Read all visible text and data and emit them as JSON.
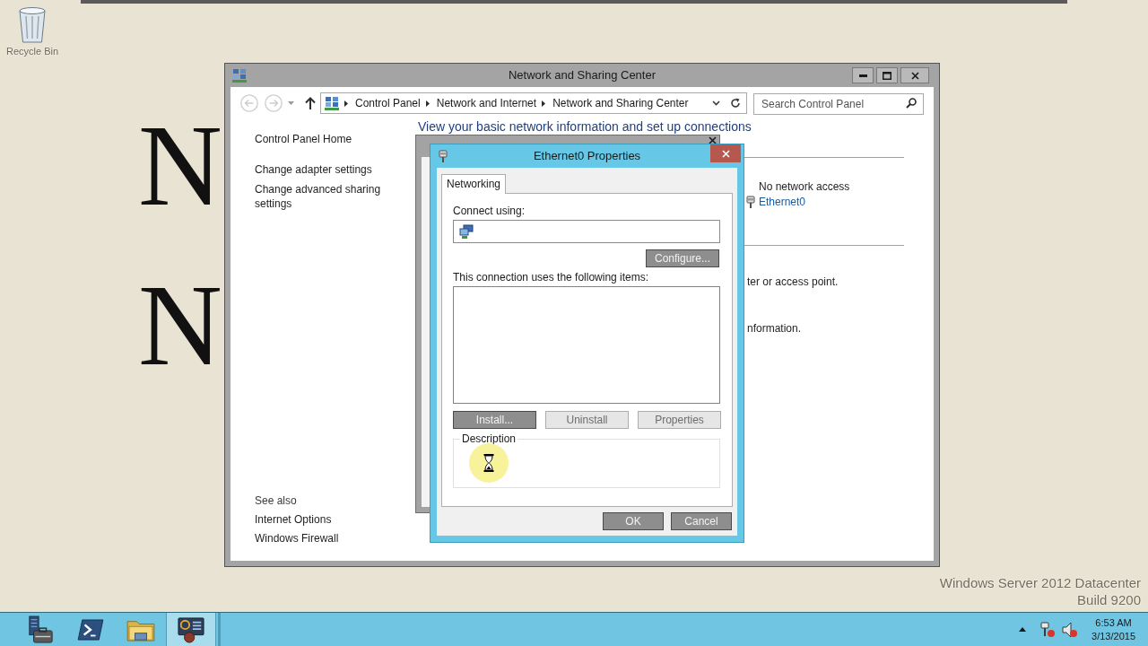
{
  "desktop": {
    "icons": [
      {
        "label": "Recycle Bin"
      }
    ],
    "background_letters": [
      "N",
      "N"
    ],
    "watermark": {
      "edition": "Windows Server 2012 Datacenter",
      "build": "Build 9200"
    }
  },
  "window": {
    "title": "Network and Sharing Center",
    "active": false,
    "nav": {
      "back": {
        "disabled": true
      },
      "forward": {
        "disabled": true
      },
      "up": {
        "disabled": false
      }
    },
    "address": {
      "breadcrumbs": [
        "Control Panel",
        "Network and Internet",
        "Network and Sharing Center"
      ]
    },
    "search": {
      "placeholder": "Search Control Panel"
    },
    "sidebar": {
      "items": [
        "Control Panel Home",
        "Change adapter settings",
        "Change advanced sharing settings"
      ],
      "see_also": {
        "heading": "See also",
        "items": [
          "Internet Options",
          "Windows Firewall"
        ]
      }
    },
    "content": {
      "heading": "View your basic network information and set up connections",
      "access_type": "No network access",
      "connection": "Ethernet0",
      "partial_lines": [
        "ter or access point.",
        "nformation."
      ]
    }
  },
  "dialog": {
    "title": "Ethernet0 Properties",
    "active": true,
    "tabs": [
      {
        "label": "Networking",
        "selected": true
      }
    ],
    "connect_using_label": "Connect using:",
    "configure_button": {
      "label": "Configure...",
      "highlighted": true
    },
    "items_label": "This connection uses the following items:",
    "item_buttons": [
      {
        "label": "Install...",
        "highlighted": true
      },
      {
        "label": "Uninstall",
        "highlighted": false
      },
      {
        "label": "Properties",
        "highlighted": false
      }
    ],
    "description_label": "Description",
    "footer_buttons": [
      {
        "label": "OK",
        "highlighted": true
      },
      {
        "label": "Cancel",
        "highlighted": true
      }
    ]
  },
  "taskbar": {
    "apps": [
      {
        "kind": "server-manager",
        "selected": false
      },
      {
        "kind": "powershell",
        "selected": false
      },
      {
        "kind": "file-explorer",
        "selected": false
      },
      {
        "kind": "network-center",
        "selected": true
      }
    ],
    "tray": {
      "network_disconnected": true,
      "sound_muted": true
    },
    "clock": {
      "time": "6:53 AM",
      "date": "3/13/2015"
    }
  }
}
